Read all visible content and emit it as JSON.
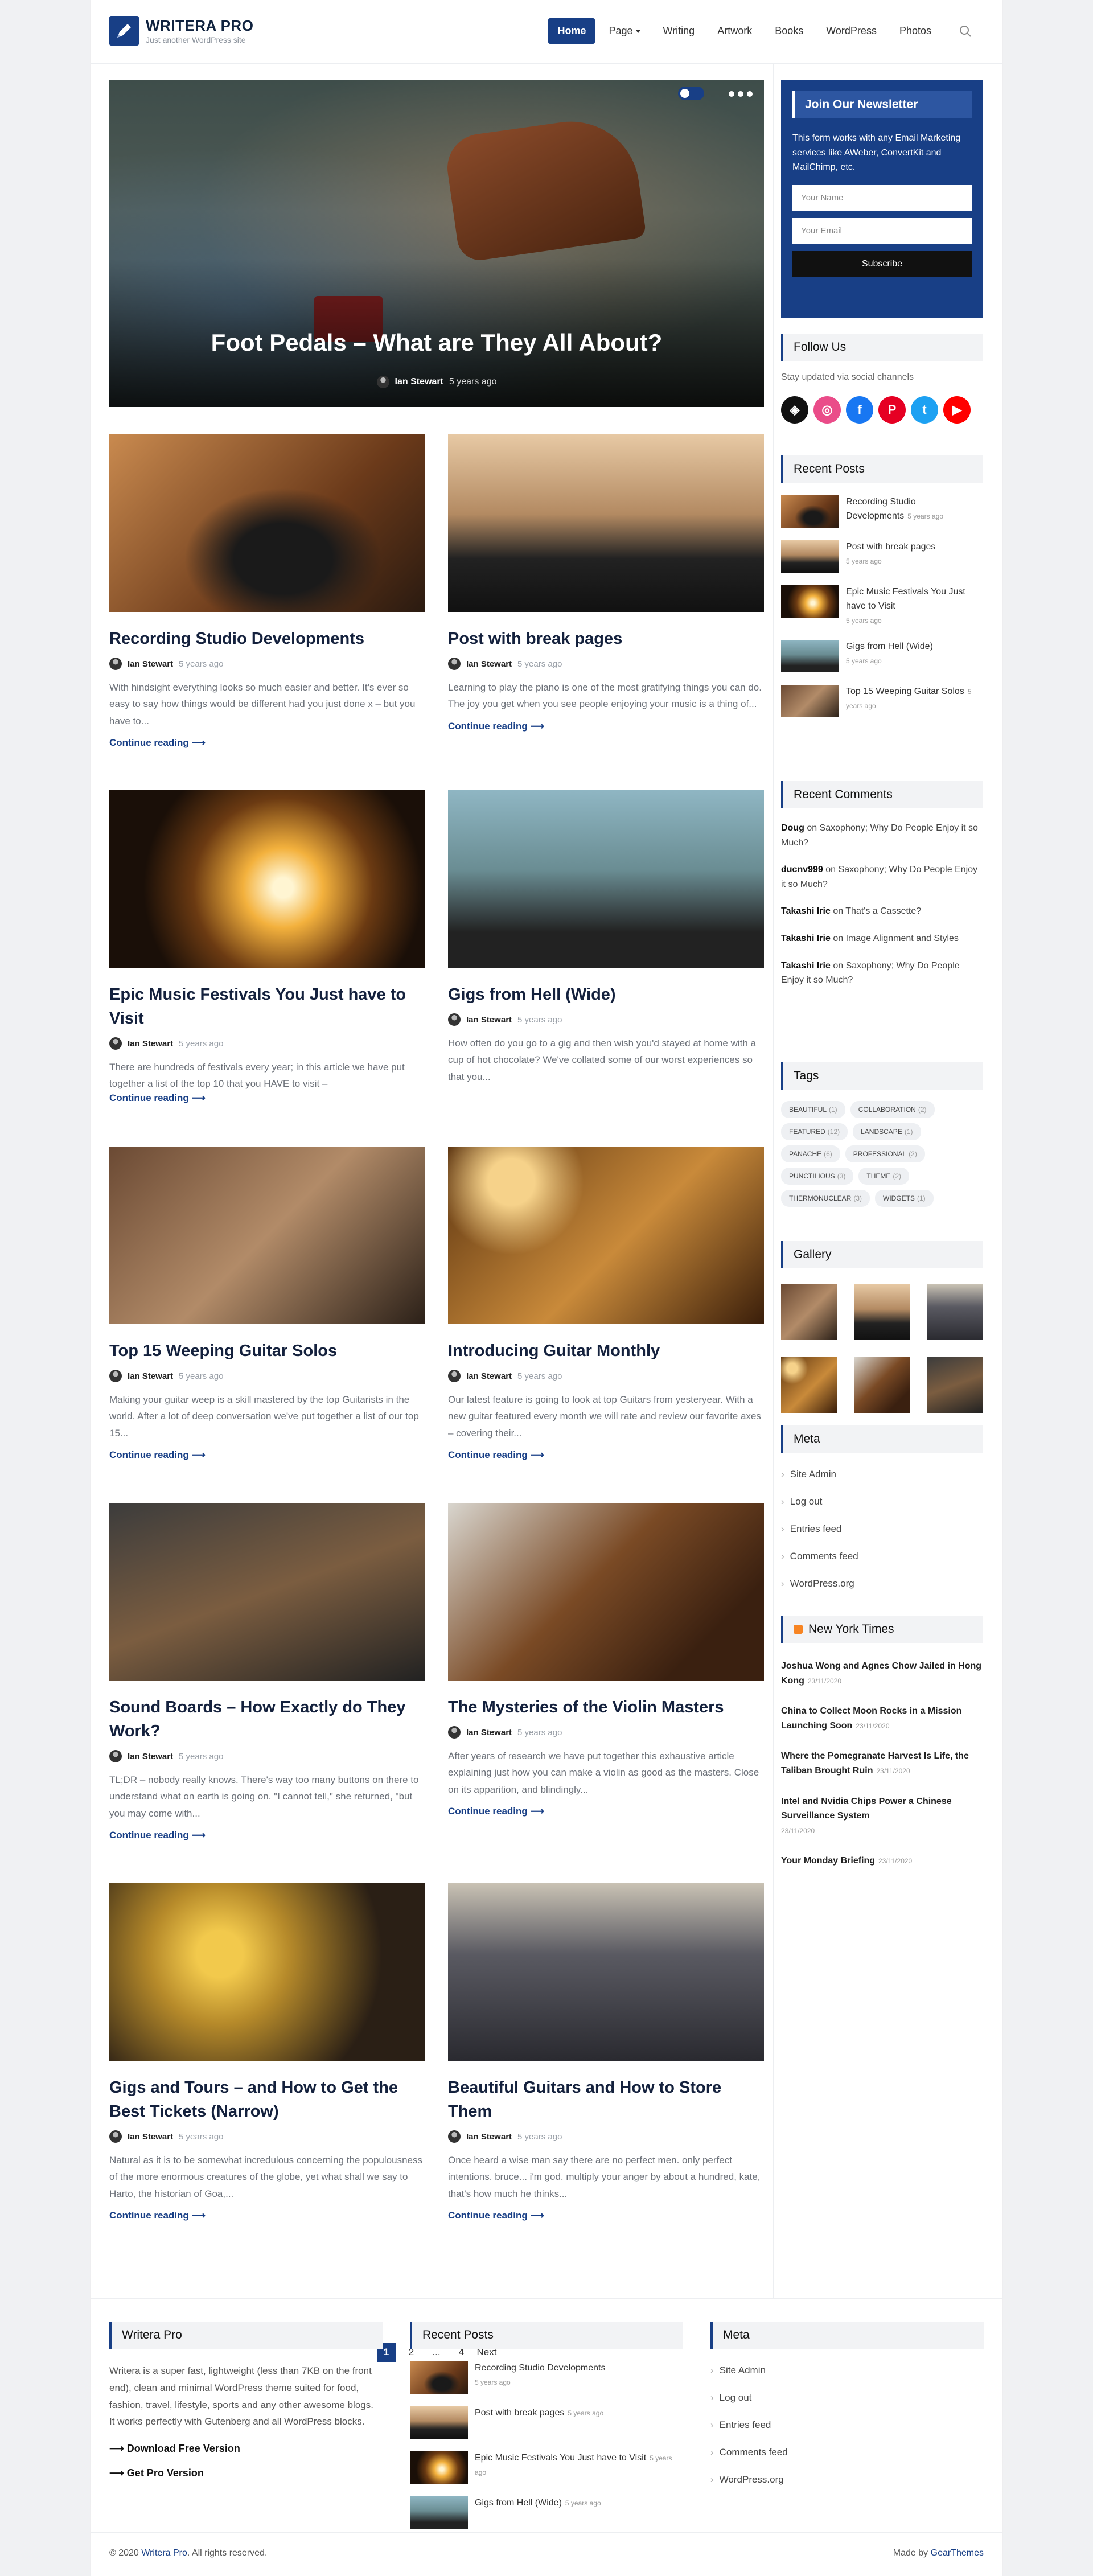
{
  "site": {
    "title": "WRITERA PRO",
    "tagline": "Just another WordPress site"
  },
  "nav": {
    "items": [
      "Home",
      "Page",
      "Writing",
      "Artwork",
      "Books",
      "WordPress",
      "Photos"
    ],
    "active": "Home"
  },
  "hero": {
    "title": "Foot Pedals – What are They All About?",
    "author": "Ian Stewart",
    "time": "5 years ago"
  },
  "posts": [
    {
      "title": "Recording Studio Developments",
      "author": "Ian Stewart",
      "time": "5 years ago",
      "excerpt": "With hindsight everything looks so much easier and better. It's ever so easy to say how things would be different had you just done x – but you have to...",
      "more": "Continue reading ⟶"
    },
    {
      "title": "Post with break pages",
      "author": "Ian Stewart",
      "time": "5 years ago",
      "excerpt": "Learning to play the piano is one of the most gratifying things you can do. The joy you get when you see people enjoying your music is a thing of...",
      "more": "Continue reading ⟶"
    },
    {
      "title": "Epic Music Festivals You Just have to Visit",
      "author": "Ian Stewart",
      "time": "5 years ago",
      "excerpt": "There are hundreds of festivals every year; in this article we have put together a list of the top 10 that you HAVE to visit –",
      "more": "Continue reading ⟶"
    },
    {
      "title": "Gigs from Hell (Wide)",
      "author": "Ian Stewart",
      "time": "5 years ago",
      "excerpt": "How often do you go to a gig and then wish you'd stayed at home with a cup of hot chocolate? We've collated some of our worst experiences so that you...",
      "more": "Continue reading ⟶"
    },
    {
      "title": "Top 15 Weeping Guitar Solos",
      "author": "Ian Stewart",
      "time": "5 years ago",
      "excerpt": "Making your guitar weep is a skill mastered by the top Guitarists in the world. After a lot of deep conversation we've put together a list of our top 15...",
      "more": "Continue reading ⟶"
    },
    {
      "title": "Introducing Guitar Monthly",
      "author": "Ian Stewart",
      "time": "5 years ago",
      "excerpt": "Our latest feature is going to look at top Guitars from yesteryear. With a new guitar featured every month we will rate and review our favorite axes – covering their...",
      "more": "Continue reading ⟶"
    },
    {
      "title": "Sound Boards – How Exactly do They Work?",
      "author": "Ian Stewart",
      "time": "5 years ago",
      "excerpt": "TL;DR – nobody really knows. There's way too many buttons on there to understand what on earth is going on. \"I cannot tell,\" she returned, \"but you may come with...",
      "more": "Continue reading ⟶"
    },
    {
      "title": "The Mysteries of the Violin Masters",
      "author": "Ian Stewart",
      "time": "5 years ago",
      "excerpt": "After years of research we have put together this exhaustive article explaining just how you can make a violin as good as the masters. Close on its apparition, and blindingly...",
      "more": "Continue reading ⟶"
    },
    {
      "title": "Gigs and Tours – and How to Get the Best Tickets (Narrow)",
      "author": "Ian Stewart",
      "time": "5 years ago",
      "excerpt": "Natural as it is to be somewhat incredulous concerning the populousness of the more enormous creatures of the globe, yet what shall we say to Harto, the historian of Goa,...",
      "more": "Continue reading ⟶"
    },
    {
      "title": "Beautiful Guitars and How to Store Them",
      "author": "Ian Stewart",
      "time": "5 years ago",
      "excerpt": "Once heard a wise man say there are no perfect men. only perfect intentions. bruce... i'm god. multiply your anger by about a hundred, kate, that's how much he thinks...",
      "more": "Continue reading ⟶"
    }
  ],
  "pagination": [
    "1",
    "2",
    "...",
    "4",
    "Next"
  ],
  "sidebar": {
    "newsletter": {
      "title": "Join Our Newsletter",
      "text": "This form works with any Email Marketing services like AWeber, ConvertKit and MailChimp, etc.",
      "name_placeholder": "Your Name",
      "email_placeholder": "Your Email",
      "button": "Subscribe"
    },
    "follow": {
      "title": "Follow Us",
      "text": "Stay updated via social channels",
      "icons": [
        "codepen-icon",
        "dribbble-icon",
        "facebook-icon",
        "pinterest-icon",
        "twitter-icon",
        "youtube-icon"
      ],
      "colors": [
        "#111111",
        "#ea4c89",
        "#1877f2",
        "#e60023",
        "#1da1f2",
        "#ff0000"
      ]
    },
    "recent_posts": {
      "title": "Recent Posts",
      "items": [
        {
          "title": "Recording Studio Developments",
          "time": "5 years ago"
        },
        {
          "title": "Post with break pages",
          "time": "5 years ago"
        },
        {
          "title": "Epic Music Festivals You Just have to Visit",
          "time": "5 years ago"
        },
        {
          "title": "Gigs from Hell (Wide)",
          "time": "5 years ago"
        },
        {
          "title": "Top 15 Weeping Guitar Solos",
          "time": "5 years ago"
        }
      ]
    },
    "recent_comments": {
      "title": "Recent Comments",
      "items": [
        {
          "author": "Doug",
          "on": "on",
          "post": "Saxophony; Why Do People Enjoy it so Much?"
        },
        {
          "author": "ducnv999",
          "on": "on",
          "post": "Saxophony; Why Do People Enjoy it so Much?"
        },
        {
          "author": "Takashi Irie",
          "on": "on",
          "post": "That's a Cassette?"
        },
        {
          "author": "Takashi Irie",
          "on": "on",
          "post": "Image Alignment and Styles"
        },
        {
          "author": "Takashi Irie",
          "on": "on",
          "post": "Saxophony; Why Do People Enjoy it so Much?"
        }
      ]
    },
    "tags": {
      "title": "Tags",
      "items": [
        {
          "name": "Beautiful",
          "count": "(1)"
        },
        {
          "name": "Collaboration",
          "count": "(2)"
        },
        {
          "name": "Featured",
          "count": "(12)"
        },
        {
          "name": "Landscape",
          "count": "(1)"
        },
        {
          "name": "Panache",
          "count": "(6)"
        },
        {
          "name": "Professional",
          "count": "(2)"
        },
        {
          "name": "Punctilious",
          "count": "(3)"
        },
        {
          "name": "Theme",
          "count": "(2)"
        },
        {
          "name": "Thermonuclear",
          "count": "(3)"
        },
        {
          "name": "Widgets",
          "count": "(1)"
        }
      ]
    },
    "gallery": {
      "title": "Gallery"
    },
    "meta": {
      "title": "Meta",
      "items": [
        "Site Admin",
        "Log out",
        "Entries feed",
        "Comments feed",
        "WordPress.org"
      ]
    },
    "nyt": {
      "title": "New York Times",
      "items": [
        {
          "title": "Joshua Wong and Agnes Chow Jailed in Hong Kong",
          "date": "23/11/2020"
        },
        {
          "title": "China to Collect Moon Rocks in a Mission Launching Soon",
          "date": "23/11/2020"
        },
        {
          "title": "Where the Pomegranate Harvest Is Life, the Taliban Brought Ruin",
          "date": "23/11/2020"
        },
        {
          "title": "Intel and Nvidia Chips Power a Chinese Surveillance System",
          "date": "23/11/2020"
        },
        {
          "title": "Your Monday Briefing",
          "date": "23/11/2020"
        }
      ]
    }
  },
  "footer": {
    "about": {
      "title": "Writera Pro",
      "text": "Writera is a super fast, lightweight (less than 7KB on the front end), clean and minimal WordPress theme suited for food, fashion, travel, lifestyle, sports and any other awesome blogs. It works perfectly with Gutenberg and all WordPress blocks.",
      "link1": "⟶ Download Free Version",
      "link2": "⟶ Get Pro Version"
    },
    "recent": {
      "title": "Recent Posts",
      "items": [
        {
          "title": "Recording Studio Developments",
          "time": "5 years ago"
        },
        {
          "title": "Post with break pages",
          "time": "5 years ago"
        },
        {
          "title": "Epic Music Festivals You Just have to Visit",
          "time": "5 years ago"
        },
        {
          "title": "Gigs from Hell (Wide)",
          "time": "5 years ago"
        }
      ]
    },
    "meta": {
      "title": "Meta",
      "items": [
        "Site Admin",
        "Log out",
        "Entries feed",
        "Comments feed",
        "WordPress.org"
      ]
    },
    "copyright_pre": "© 2020",
    "copyright_brand": "Writera Pro",
    "copyright_post": ". All rights reserved.",
    "made_by_pre": "Made by",
    "made_by_brand": "GearThemes"
  },
  "colors": {
    "accent": "#183f86"
  }
}
